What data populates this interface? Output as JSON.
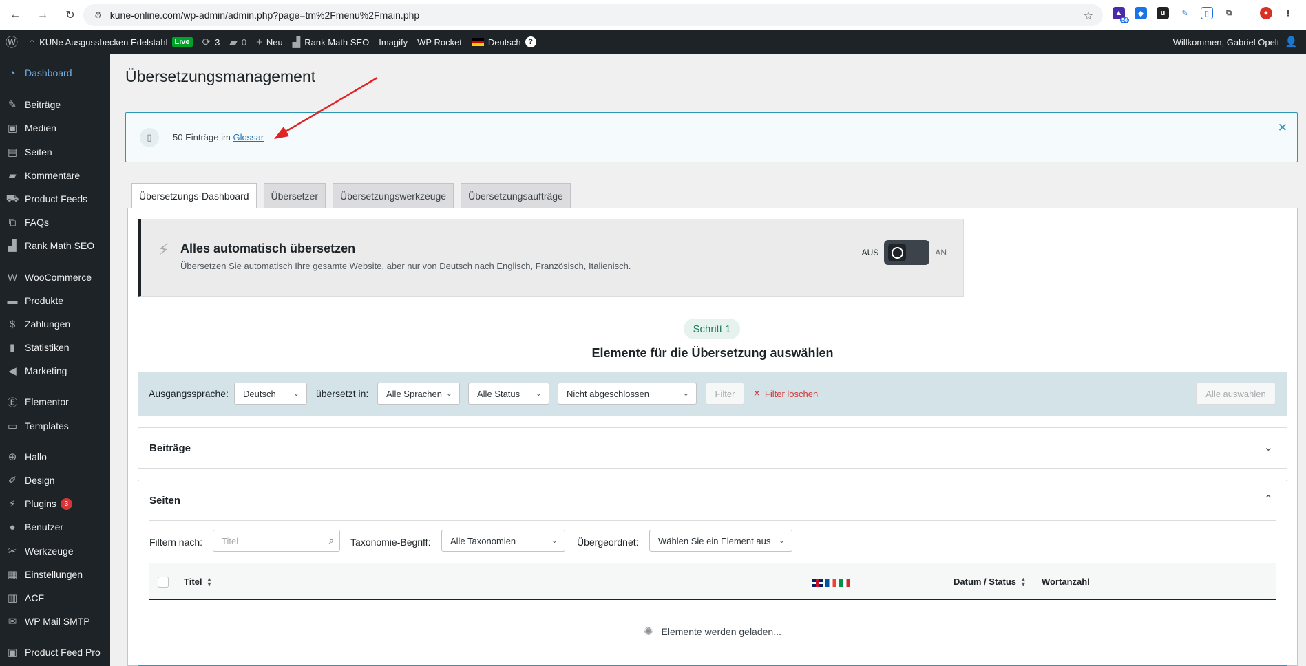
{
  "browser": {
    "url": "kune-online.com/wp-admin/admin.php?page=tm%2Fmenu%2Fmain.php",
    "ext_badge": "56"
  },
  "adminbar": {
    "site_name": "KUNe Ausgussbecken Edelstahl",
    "live": "Live",
    "updates": "3",
    "comments": "0",
    "new": "Neu",
    "rankmath": "Rank Math SEO",
    "imagify": "Imagify",
    "wprocket": "WP Rocket",
    "language": "Deutsch",
    "help": "?",
    "welcome": "Willkommen, Gabriel Opelt"
  },
  "sidebar": {
    "items": [
      {
        "label": "Dashboard",
        "icon": "dashboard-icon"
      },
      {
        "label": "Beiträge",
        "icon": "pin-icon"
      },
      {
        "label": "Medien",
        "icon": "media-icon"
      },
      {
        "label": "Seiten",
        "icon": "pages-icon"
      },
      {
        "label": "Kommentare",
        "icon": "comment-icon"
      },
      {
        "label": "Product Feeds",
        "icon": "cart-icon"
      },
      {
        "label": "FAQs",
        "icon": "faq-icon"
      },
      {
        "label": "Rank Math SEO",
        "icon": "chart-icon"
      },
      {
        "label": "WooCommerce",
        "icon": "woo-icon"
      },
      {
        "label": "Produkte",
        "icon": "archive-icon"
      },
      {
        "label": "Zahlungen",
        "icon": "dollar-icon"
      },
      {
        "label": "Statistiken",
        "icon": "stats-icon"
      },
      {
        "label": "Marketing",
        "icon": "megaphone-icon"
      },
      {
        "label": "Elementor",
        "icon": "elementor-icon"
      },
      {
        "label": "Templates",
        "icon": "folder-icon"
      },
      {
        "label": "Hallo",
        "icon": "plus-circle-icon"
      },
      {
        "label": "Design",
        "icon": "brush-icon"
      },
      {
        "label": "Plugins",
        "icon": "plug-icon",
        "badge": "3"
      },
      {
        "label": "Benutzer",
        "icon": "user-icon"
      },
      {
        "label": "Werkzeuge",
        "icon": "wrench-icon"
      },
      {
        "label": "Einstellungen",
        "icon": "settings-icon"
      },
      {
        "label": "ACF",
        "icon": "acf-icon"
      },
      {
        "label": "WP Mail SMTP",
        "icon": "mail-icon"
      },
      {
        "label": "Product Feed Pro",
        "icon": "feed-icon"
      }
    ]
  },
  "page": {
    "title": "Übersetzungsmanagement"
  },
  "notice": {
    "text": "50 Einträge im",
    "link": "Glossar"
  },
  "tabs": [
    {
      "label": "Übersetzungs-Dashboard",
      "active": true
    },
    {
      "label": "Übersetzer",
      "active": false
    },
    {
      "label": "Übersetzungswerkzeuge",
      "active": false
    },
    {
      "label": "Übersetzungsaufträge",
      "active": false
    }
  ],
  "auto_translate": {
    "title": "Alles automatisch übersetzen",
    "description": "Übersetzen Sie automatisch Ihre gesamte Website, aber nur von Deutsch nach Englisch, Französisch, Italienisch.",
    "off_label": "AUS",
    "on_label": "AN",
    "enabled": false
  },
  "step": {
    "pill": "Schritt 1",
    "title": "Elemente für die Übersetzung auswählen"
  },
  "filters": {
    "source_label": "Ausgangssprache:",
    "source_value": "Deutsch",
    "translated_label": "übersetzt in:",
    "languages_value": "Alle Sprachen",
    "status_value": "Alle Status",
    "completion_value": "Nicht abgeschlossen",
    "filter_button": "Filter",
    "clear_button": "Filter löschen",
    "select_all": "Alle auswählen"
  },
  "sections": {
    "posts_title": "Beiträge",
    "pages_title": "Seiten",
    "filter_by_label": "Filtern nach:",
    "title_placeholder": "Titel",
    "taxonomy_label": "Taxonomie-Begriff:",
    "taxonomy_value": "Alle Taxonomien",
    "parent_label": "Übergeordnet:",
    "parent_value": "Wählen Sie ein Element aus"
  },
  "table": {
    "col_title": "Titel",
    "col_date": "Datum / Status",
    "col_words": "Wortanzahl",
    "loading": "Elemente werden geladen..."
  }
}
